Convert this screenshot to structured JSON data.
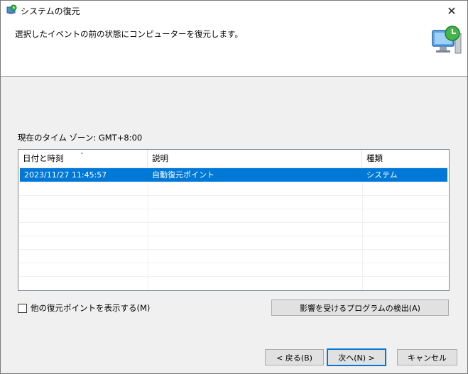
{
  "window": {
    "title": "システムの復元"
  },
  "header": {
    "instruction": "選択したイベントの前の状態にコンピューターを復元します。"
  },
  "timezone": {
    "label": "現在のタイム ゾーン: GMT+8:00"
  },
  "restore_list": {
    "columns": [
      "日付と時刻",
      "説明",
      "種類"
    ],
    "rows": [
      {
        "datetime": "2023/11/27 11:45:57",
        "description": "自動復元ポイント",
        "type": "システム",
        "selected": true
      }
    ],
    "sort_indicator": "⌄"
  },
  "options": {
    "show_more_label": "他の復元ポイントを表示する(M)",
    "show_more_checked": false,
    "scan_button_label": "影響を受けるプログラムの検出(A)"
  },
  "footer": {
    "back_label": "< 戻る(B)",
    "next_label": "次へ(N) >",
    "cancel_label": "キャンセル"
  },
  "colors": {
    "selection": "#0078d7",
    "background": "#f0f0f0",
    "header_bg": "#ffffff"
  },
  "icons": {
    "title_icon": "system-restore-icon",
    "header_icon": "computer-restore-icon",
    "close_icon": "close-icon"
  }
}
